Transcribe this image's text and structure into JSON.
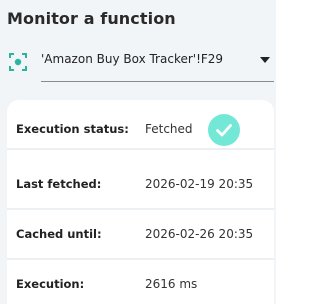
{
  "header": {
    "title": "Monitor a function"
  },
  "function_selector": {
    "icon": "target-focus-icon",
    "selected_value": "'Amazon Buy Box Tracker'!F29"
  },
  "status": {
    "rows": [
      {
        "label": "Execution status:",
        "value": "Fetched",
        "icon": "check-circle-icon"
      },
      {
        "label": "Last fetched:",
        "value": "2026-02-19 20:35"
      },
      {
        "label": "Cached until:",
        "value": "2026-02-26 20:35"
      },
      {
        "label": "Execution:",
        "value": "2616 ms"
      }
    ]
  },
  "colors": {
    "accent": "#74e8d6",
    "icon_teal": "#2bb5a0",
    "panel_bg": "#f2f5f8"
  }
}
